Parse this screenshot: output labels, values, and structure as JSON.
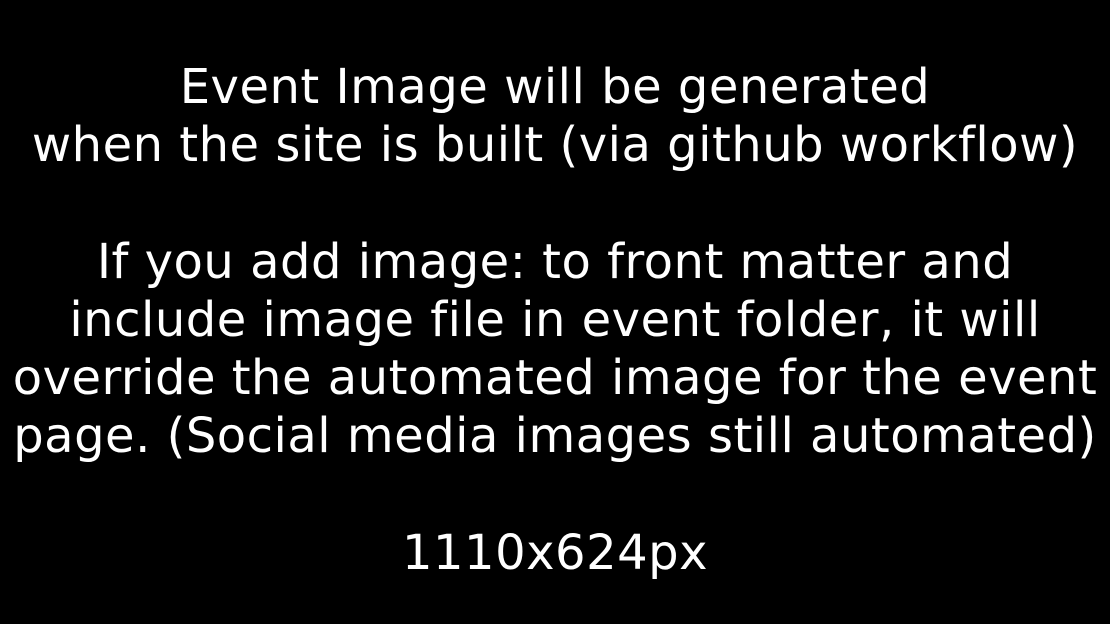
{
  "placeholder": {
    "heading_line_1": "Event Image will be generated",
    "heading_line_2": "when the site is built (via github workflow)",
    "note_line_1": "If you add image: to front matter and",
    "note_line_2": "include image file in event folder, it will",
    "note_line_3": "override the automated image for the event",
    "note_line_4": "page. (Social media images still automated)",
    "dimensions": "1110x624px"
  },
  "colors": {
    "background": "#000000",
    "text": "#ffffff"
  }
}
